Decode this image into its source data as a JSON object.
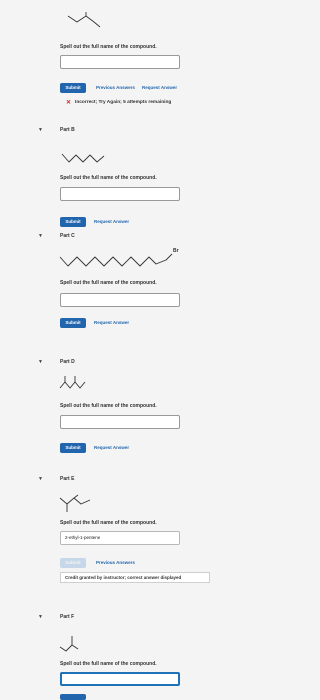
{
  "part_a": {
    "prompt": "Spell out the full name of the compound.",
    "submit_label": "Submit",
    "previous_answers_label": "Previous Answers",
    "request_answer_label": "Request Answer",
    "feedback_text": "Incorrect; Try Again; 5 attempts remaining"
  },
  "part_b": {
    "title": "Part B",
    "prompt": "Spell out the full name of the compound.",
    "submit_label": "Submit",
    "request_answer_label": "Request Answer"
  },
  "part_c": {
    "title": "Part C",
    "atom_label": "Br",
    "prompt": "Spell out the full name of the compound.",
    "submit_label": "Submit",
    "request_answer_label": "Request Answer"
  },
  "part_d": {
    "title": "Part D",
    "prompt": "Spell out the full name of the compound.",
    "submit_label": "Submit",
    "request_answer_label": "Request Answer"
  },
  "part_e": {
    "title": "Part E",
    "prompt": "Spell out the full name of the compound.",
    "answer_value": "2-ethyl-1-pentene",
    "submit_label": "Submit",
    "previous_answers_label": "Previous Answers",
    "credit_text": "Credit granted by instructor; correct answer displayed"
  },
  "part_f": {
    "title": "Part F",
    "prompt": "Spell out the full name of the compound."
  },
  "icons": {
    "incorrect": "x-icon",
    "collapse": "chevron-down-icon"
  },
  "colors": {
    "accent": "#2166ad",
    "error": "#d3261f",
    "active_border": "#1f72b8"
  }
}
